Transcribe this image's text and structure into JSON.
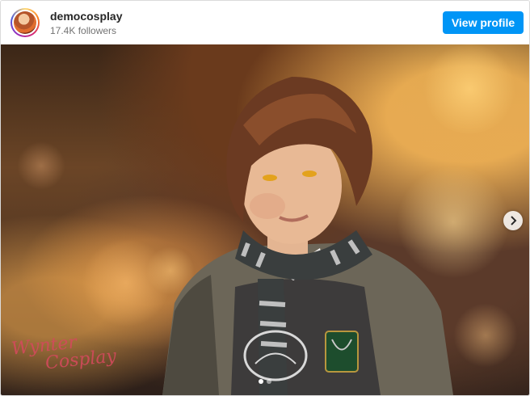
{
  "header": {
    "username": "democosplay",
    "followers": "17.4K followers",
    "view_profile_label": "View profile"
  },
  "post": {
    "watermark_line1": "Wynter",
    "watermark_line2": "Cosplay",
    "carousel": {
      "total": 2,
      "active_index": 0
    },
    "next_icon": "chevron-right-icon"
  },
  "colors": {
    "button_blue": "#0095f6",
    "username": "#262626",
    "secondary_text": "#737373",
    "watermark": "#d34a5c"
  }
}
